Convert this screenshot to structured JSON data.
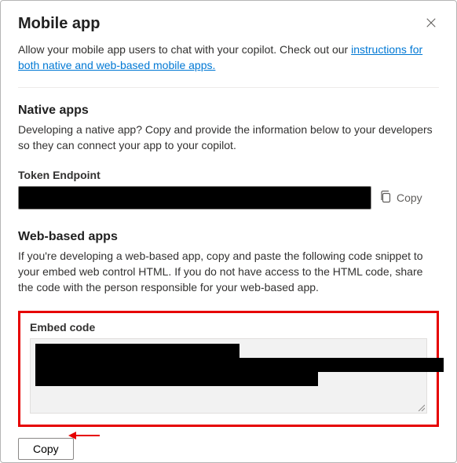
{
  "header": {
    "title": "Mobile app"
  },
  "intro": {
    "text_before": "Allow your mobile app users to chat with your copilot. Check out our ",
    "link_text": "instructions for both native and web-based mobile apps.",
    "link_href": "#"
  },
  "native": {
    "title": "Native apps",
    "desc": "Developing a native app? Copy and provide the information below to your developers so they can connect your app to your copilot.",
    "token_label": "Token Endpoint",
    "token_value": "",
    "copy_label": "Copy"
  },
  "web": {
    "title": "Web-based apps",
    "desc": "If you're developing a web-based app, copy and paste the following code snippet to your embed web control HTML. If you do not have access to the HTML code, share the code with the person responsible for your web-based app.",
    "embed_label": "Embed code",
    "embed_value": ""
  },
  "actions": {
    "copy_button": "Copy"
  }
}
